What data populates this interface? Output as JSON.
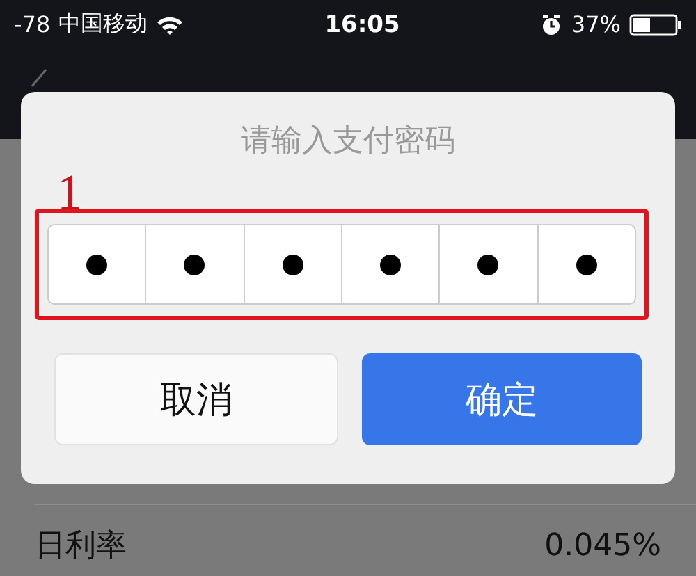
{
  "status_bar": {
    "signal": "-78",
    "carrier": "中国移动",
    "time": "16:05",
    "battery": "37%"
  },
  "dialog": {
    "title": "请输入支付密码",
    "annotation": "1",
    "digits": [
      {
        "filled": true
      },
      {
        "filled": true
      },
      {
        "filled": true
      },
      {
        "filled": true
      },
      {
        "filled": true
      },
      {
        "filled": true
      }
    ],
    "buttons": [
      {
        "label": "取消",
        "kind": "cancel"
      },
      {
        "label": "确定",
        "kind": "confirm"
      }
    ]
  },
  "rows": [
    {
      "label": "日利率",
      "value": "0.045%"
    }
  ]
}
